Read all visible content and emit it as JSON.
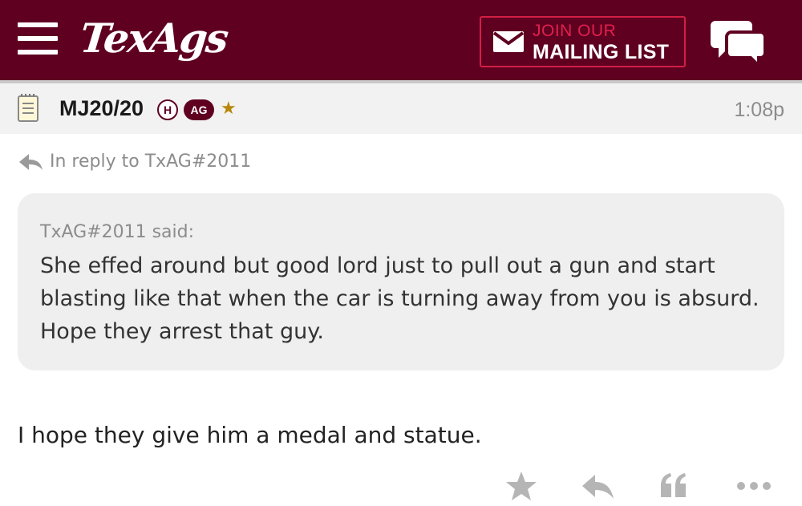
{
  "header": {
    "logo_text": "TexAgs",
    "mailing": {
      "line1": "JOIN OUR",
      "line2": "MAILING LIST"
    },
    "icons": {
      "menu": "hamburger-menu-icon",
      "mail": "envelope-icon",
      "chat": "chat-bubbles-icon"
    }
  },
  "post": {
    "username": "MJ20/20",
    "badges": {
      "h": "H",
      "ag": "AG"
    },
    "time": "1:08p",
    "reply_to": "In reply to TxAG#2011",
    "quote": {
      "author": "TxAG#2011 said:",
      "text": "She effed around but good lord just to pull out a gun and start blasting like that when the car is turning away from you is absurd. Hope they arrest that guy."
    },
    "body": "I hope they give him a medal and statue."
  },
  "actions": [
    "star-icon",
    "reply-icon",
    "quote-icon",
    "more-icon"
  ],
  "colors": {
    "brand": "#5f0021",
    "accent": "#e0204b",
    "muted": "#8c8c8c",
    "star_gold": "#b8860b"
  }
}
